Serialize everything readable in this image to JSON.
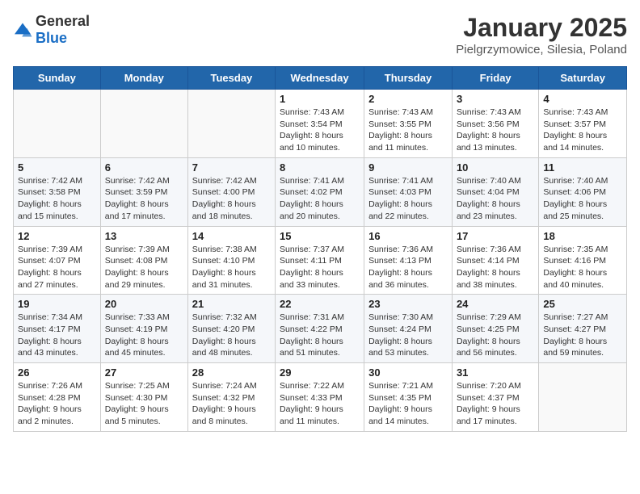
{
  "header": {
    "logo_general": "General",
    "logo_blue": "Blue",
    "title": "January 2025",
    "subtitle": "Pielgrzymowice, Silesia, Poland"
  },
  "columns": [
    "Sunday",
    "Monday",
    "Tuesday",
    "Wednesday",
    "Thursday",
    "Friday",
    "Saturday"
  ],
  "weeks": [
    [
      {
        "day": "",
        "info": ""
      },
      {
        "day": "",
        "info": ""
      },
      {
        "day": "",
        "info": ""
      },
      {
        "day": "1",
        "info": "Sunrise: 7:43 AM\nSunset: 3:54 PM\nDaylight: 8 hours\nand 10 minutes."
      },
      {
        "day": "2",
        "info": "Sunrise: 7:43 AM\nSunset: 3:55 PM\nDaylight: 8 hours\nand 11 minutes."
      },
      {
        "day": "3",
        "info": "Sunrise: 7:43 AM\nSunset: 3:56 PM\nDaylight: 8 hours\nand 13 minutes."
      },
      {
        "day": "4",
        "info": "Sunrise: 7:43 AM\nSunset: 3:57 PM\nDaylight: 8 hours\nand 14 minutes."
      }
    ],
    [
      {
        "day": "5",
        "info": "Sunrise: 7:42 AM\nSunset: 3:58 PM\nDaylight: 8 hours\nand 15 minutes."
      },
      {
        "day": "6",
        "info": "Sunrise: 7:42 AM\nSunset: 3:59 PM\nDaylight: 8 hours\nand 17 minutes."
      },
      {
        "day": "7",
        "info": "Sunrise: 7:42 AM\nSunset: 4:00 PM\nDaylight: 8 hours\nand 18 minutes."
      },
      {
        "day": "8",
        "info": "Sunrise: 7:41 AM\nSunset: 4:02 PM\nDaylight: 8 hours\nand 20 minutes."
      },
      {
        "day": "9",
        "info": "Sunrise: 7:41 AM\nSunset: 4:03 PM\nDaylight: 8 hours\nand 22 minutes."
      },
      {
        "day": "10",
        "info": "Sunrise: 7:40 AM\nSunset: 4:04 PM\nDaylight: 8 hours\nand 23 minutes."
      },
      {
        "day": "11",
        "info": "Sunrise: 7:40 AM\nSunset: 4:06 PM\nDaylight: 8 hours\nand 25 minutes."
      }
    ],
    [
      {
        "day": "12",
        "info": "Sunrise: 7:39 AM\nSunset: 4:07 PM\nDaylight: 8 hours\nand 27 minutes."
      },
      {
        "day": "13",
        "info": "Sunrise: 7:39 AM\nSunset: 4:08 PM\nDaylight: 8 hours\nand 29 minutes."
      },
      {
        "day": "14",
        "info": "Sunrise: 7:38 AM\nSunset: 4:10 PM\nDaylight: 8 hours\nand 31 minutes."
      },
      {
        "day": "15",
        "info": "Sunrise: 7:37 AM\nSunset: 4:11 PM\nDaylight: 8 hours\nand 33 minutes."
      },
      {
        "day": "16",
        "info": "Sunrise: 7:36 AM\nSunset: 4:13 PM\nDaylight: 8 hours\nand 36 minutes."
      },
      {
        "day": "17",
        "info": "Sunrise: 7:36 AM\nSunset: 4:14 PM\nDaylight: 8 hours\nand 38 minutes."
      },
      {
        "day": "18",
        "info": "Sunrise: 7:35 AM\nSunset: 4:16 PM\nDaylight: 8 hours\nand 40 minutes."
      }
    ],
    [
      {
        "day": "19",
        "info": "Sunrise: 7:34 AM\nSunset: 4:17 PM\nDaylight: 8 hours\nand 43 minutes."
      },
      {
        "day": "20",
        "info": "Sunrise: 7:33 AM\nSunset: 4:19 PM\nDaylight: 8 hours\nand 45 minutes."
      },
      {
        "day": "21",
        "info": "Sunrise: 7:32 AM\nSunset: 4:20 PM\nDaylight: 8 hours\nand 48 minutes."
      },
      {
        "day": "22",
        "info": "Sunrise: 7:31 AM\nSunset: 4:22 PM\nDaylight: 8 hours\nand 51 minutes."
      },
      {
        "day": "23",
        "info": "Sunrise: 7:30 AM\nSunset: 4:24 PM\nDaylight: 8 hours\nand 53 minutes."
      },
      {
        "day": "24",
        "info": "Sunrise: 7:29 AM\nSunset: 4:25 PM\nDaylight: 8 hours\nand 56 minutes."
      },
      {
        "day": "25",
        "info": "Sunrise: 7:27 AM\nSunset: 4:27 PM\nDaylight: 8 hours\nand 59 minutes."
      }
    ],
    [
      {
        "day": "26",
        "info": "Sunrise: 7:26 AM\nSunset: 4:28 PM\nDaylight: 9 hours\nand 2 minutes."
      },
      {
        "day": "27",
        "info": "Sunrise: 7:25 AM\nSunset: 4:30 PM\nDaylight: 9 hours\nand 5 minutes."
      },
      {
        "day": "28",
        "info": "Sunrise: 7:24 AM\nSunset: 4:32 PM\nDaylight: 9 hours\nand 8 minutes."
      },
      {
        "day": "29",
        "info": "Sunrise: 7:22 AM\nSunset: 4:33 PM\nDaylight: 9 hours\nand 11 minutes."
      },
      {
        "day": "30",
        "info": "Sunrise: 7:21 AM\nSunset: 4:35 PM\nDaylight: 9 hours\nand 14 minutes."
      },
      {
        "day": "31",
        "info": "Sunrise: 7:20 AM\nSunset: 4:37 PM\nDaylight: 9 hours\nand 17 minutes."
      },
      {
        "day": "",
        "info": ""
      }
    ]
  ]
}
